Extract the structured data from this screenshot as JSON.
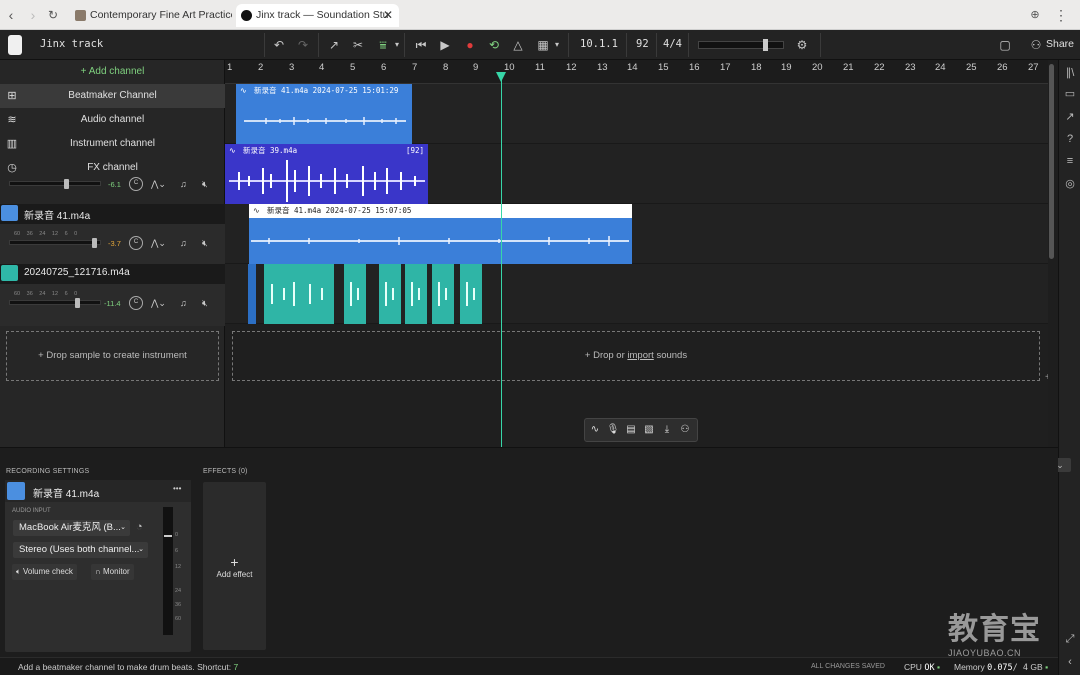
{
  "browser": {
    "tabs": [
      {
        "title": "Contemporary Fine Art Practice"
      },
      {
        "title": "Jinx track — Soundation Stu",
        "close": "✕"
      }
    ]
  },
  "toolbar": {
    "project_name": "Jinx track",
    "position": "10.1.1",
    "bpm": "92",
    "time_signature": "4/4",
    "share_label": "Share"
  },
  "channels_panel": {
    "add_channel_label": "+ Add channel",
    "menu": [
      {
        "label": "Beatmaker Channel",
        "icon": "grid-icon"
      },
      {
        "label": "Audio channel",
        "icon": "waveform-icon"
      },
      {
        "label": "Instrument channel",
        "icon": "piano-icon"
      },
      {
        "label": "FX channel",
        "icon": "fx-icon"
      }
    ],
    "channel_rows": [
      {
        "name": "",
        "volume": "-6.1",
        "meter_scale": "",
        "fader_level": 0.63,
        "accent": "#7fd17f"
      },
      {
        "name": "新录音 41.m4a",
        "volume": "-3.7",
        "meter_scale": "60 36 24 12 6 0",
        "fader_level": 0.95,
        "accent": "#4b8fe0"
      },
      {
        "name": "20240725_121716.m4a",
        "volume": "-11.4",
        "meter_scale": "60 36 24 12 6 0",
        "fader_level": 0.76,
        "accent": "#2fb8a8"
      }
    ],
    "knob_label": "C",
    "drop_instrument": "+ Drop sample to create instrument"
  },
  "timeline": {
    "bars": [
      "1",
      "2",
      "3",
      "4",
      "5",
      "6",
      "7",
      "8",
      "9",
      "10",
      "11",
      "12",
      "13",
      "14",
      "15",
      "16",
      "17",
      "18",
      "19",
      "20",
      "21",
      "22",
      "23",
      "24",
      "25",
      "26",
      "27"
    ],
    "clips": [
      {
        "title": "新录音 41.m4a 2024-07-25 15:01:29",
        "tag": ""
      },
      {
        "title": "新录音 39.m4a",
        "tag": "[92]"
      },
      {
        "title": "新录音 41.m4a 2024-07-25 15:07:05",
        "tag": ""
      }
    ],
    "drop_prefix": "+ Drop or ",
    "drop_link": "import",
    "drop_suffix": " sounds"
  },
  "recording": {
    "section_title": "RECORDING SETTINGS",
    "track_name": "新录音 41.m4a",
    "more": "•••",
    "audio_input_label": "AUDIO INPUT",
    "device": "MacBook Air麦克风 (B...",
    "channel_mode": "Stereo (Uses both channel...",
    "volume_check": "Volume check",
    "monitor": "Monitor",
    "meter_ticks": [
      "0",
      "6",
      "12",
      "24",
      "36",
      "60"
    ]
  },
  "effects": {
    "section_title": "EFFECTS (0)",
    "add_effect": "Add effect",
    "plus": "+"
  },
  "status": {
    "hint_prefix": "Add a beatmaker channel to make drum beats. Shortcut: ",
    "hint_key": "7",
    "saved": "ALL CHANGES SAVED",
    "cpu_label": "CPU",
    "cpu_value": "OK",
    "memory_label": "Memory",
    "memory_value": "0.075",
    "memory_total": "/ 4",
    "memory_unit": "GB"
  },
  "watermark": {
    "cn": "教育宝",
    "en": "JIAOYUBAO.CN"
  },
  "colors": {
    "clip_blue": "#3b7fd9",
    "clip_purple": "#3a36c9",
    "clip_teal": "#2fb5a6",
    "playhead": "#37d6a8",
    "record": "#e03b3b"
  }
}
